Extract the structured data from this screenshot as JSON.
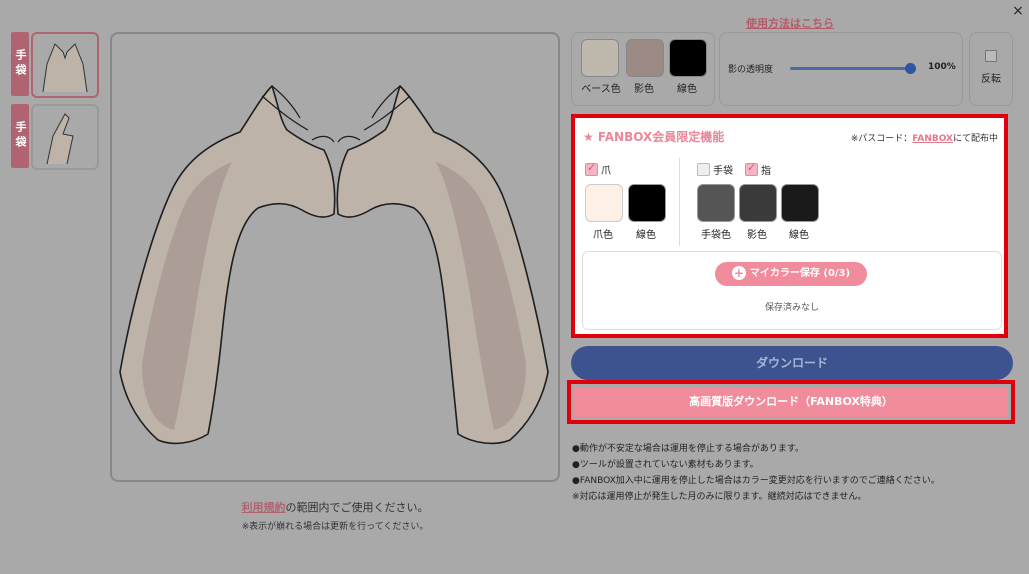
{
  "header": {
    "close": "×",
    "how_to": "使用方法はこちら"
  },
  "side_tabs": [
    {
      "label": "手袋"
    },
    {
      "label": "手袋"
    }
  ],
  "colors_panel": {
    "swatches": [
      {
        "label": "ベース色",
        "color": "#bfb8ad"
      },
      {
        "label": "影色",
        "color": "#9c8a85"
      },
      {
        "label": "線色",
        "color": "#000000"
      }
    ],
    "shadow_opacity_label": "影の透明度",
    "shadow_opacity_value": "100%",
    "shadow_opacity_level": 1.0,
    "flip_label": "反転"
  },
  "fanbox": {
    "title": "★ FANBOX会員限定機能",
    "pass_prefix": "※パスコード：",
    "pass_link": "FANBOX",
    "pass_suffix": "にて配布中",
    "nail_check_label": "爪",
    "glove_check_label": "手袋",
    "finger_check_label": "指",
    "nail_swatches": [
      {
        "label": "爪色",
        "color": "#fdf1e7"
      },
      {
        "label": "線色",
        "color": "#000000"
      }
    ],
    "glove_swatches": [
      {
        "label": "手袋色",
        "color": "#555555"
      },
      {
        "label": "影色",
        "color": "#3a3a3a"
      },
      {
        "label": "線色",
        "color": "#1a1a1a"
      }
    ],
    "save_button": "マイカラー保存 (0/3)",
    "saved_status": "保存済みなし"
  },
  "download_button": "ダウンロード",
  "hq_download_button": "高画質版ダウンロード（FANBOX特典）",
  "notes": [
    "●動作が不安定な場合は運用を停止する場合があります。",
    "●ツールが設置されていない素材もあります。",
    "●FANBOX加入中に運用を停止した場合はカラー変更対応を行いますのでご連絡ください。",
    "※対応は運用停止が発生した月のみに限ります。継続対応はできません。"
  ],
  "terms": {
    "link": "利用規約",
    "text": "の範囲内でご使用ください。"
  },
  "refresh_note": "※表示が崩れる場合は更新を行ってください。"
}
